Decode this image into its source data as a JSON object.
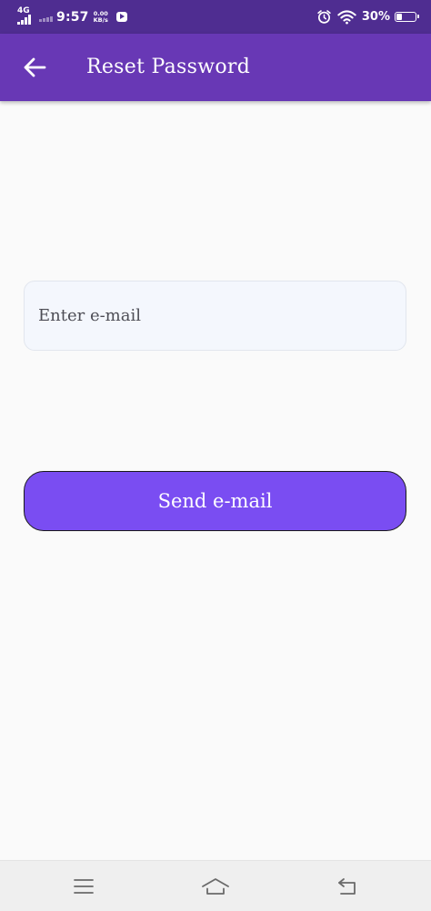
{
  "status_bar": {
    "network_type": "4G",
    "time": "9:57",
    "speed_value": "0.00",
    "speed_unit": "KB/s",
    "battery_percent": "30%",
    "battery_level": 0.3,
    "icons": [
      "signal-bars-icon",
      "youtube-notification-icon",
      "alarm-icon",
      "wifi-icon",
      "battery-icon"
    ]
  },
  "app_bar": {
    "title": "Reset Password",
    "back_icon": "arrow-left-icon"
  },
  "form": {
    "email_placeholder": "Enter e-mail",
    "email_value": "",
    "send_label": "Send e-mail"
  },
  "nav_bar": {
    "icons": [
      "menu-icon",
      "home-icon",
      "back-icon"
    ]
  },
  "colors": {
    "status_bar": "#4f2d91",
    "app_bar": "#6838b5",
    "button": "#7a4df2",
    "input_bg": "#f4f7fd",
    "page_bg": "#fafafa"
  }
}
